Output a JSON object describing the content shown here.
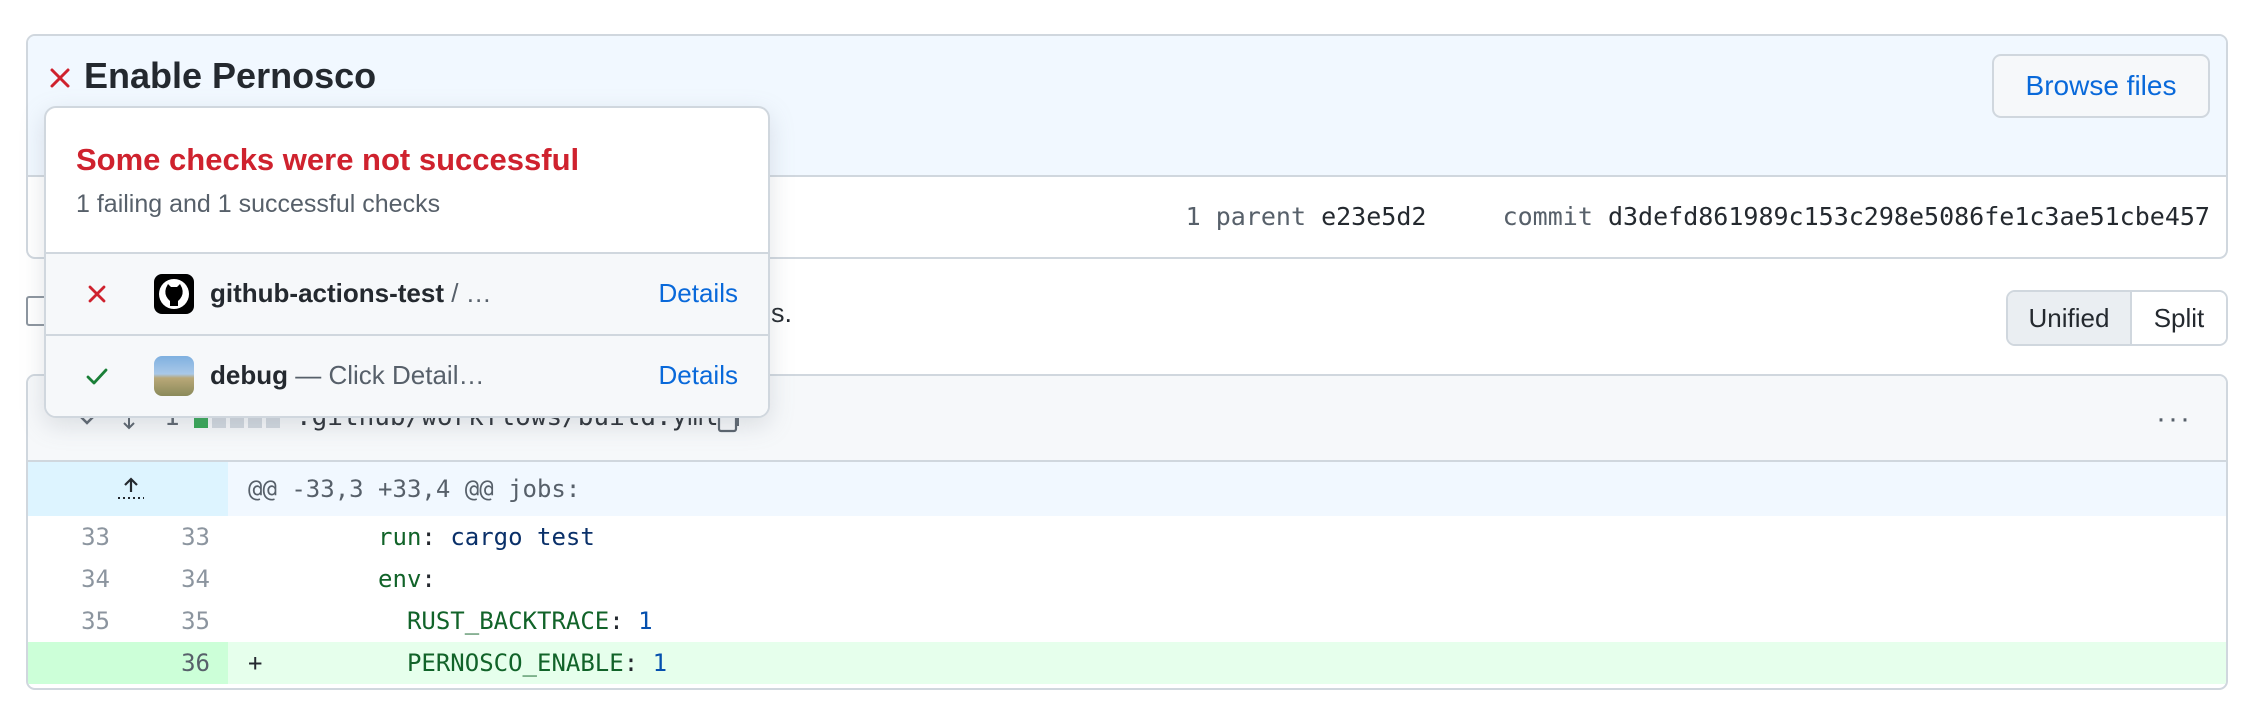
{
  "commit": {
    "title": "Enable Pernosco",
    "browse_label": "Browse files",
    "parent_label": "1 parent",
    "parent_sha": "e23e5d2",
    "commit_label": "commit",
    "commit_sha": "d3defd861989c153c298e5086fe1c3ae51cbe457"
  },
  "toolbar": {
    "diffstat_tail": "s.",
    "unified_label": "Unified",
    "split_label": "Split"
  },
  "file": {
    "changes": "1",
    "path": ".github/workflows/build.yml",
    "more_label": "···",
    "hunk_header": "@@ -33,3 +33,4 @@ jobs:",
    "lines": [
      {
        "old": "33",
        "new": "33",
        "prefix": " ",
        "indent": "        ",
        "key": "run",
        "sep": ": ",
        "value": "cargo test"
      },
      {
        "old": "34",
        "new": "34",
        "prefix": " ",
        "indent": "        ",
        "key": "env",
        "sep": ":",
        "value": ""
      },
      {
        "old": "35",
        "new": "35",
        "prefix": " ",
        "indent": "          ",
        "key": "RUST_BACKTRACE",
        "sep": ": ",
        "value": "1"
      },
      {
        "old": "",
        "new": "36",
        "prefix": "+",
        "indent": "          ",
        "key": "PERNOSCO_ENABLE",
        "sep": ": ",
        "value": "1"
      }
    ]
  },
  "checks_popover": {
    "title": "Some checks were not successful",
    "subtitle": "1 failing and 1 successful checks",
    "checks": [
      {
        "name": "github-actions-test",
        "desc": " / …",
        "details": "Details",
        "status": "failure"
      },
      {
        "name": "debug",
        "desc": " — Click Detail…",
        "details": "Details",
        "status": "success"
      }
    ]
  },
  "colors": {
    "failure": "#cf222e",
    "success": "#1a7f37",
    "link": "#0969da",
    "addition_bg": "#e6ffec"
  }
}
